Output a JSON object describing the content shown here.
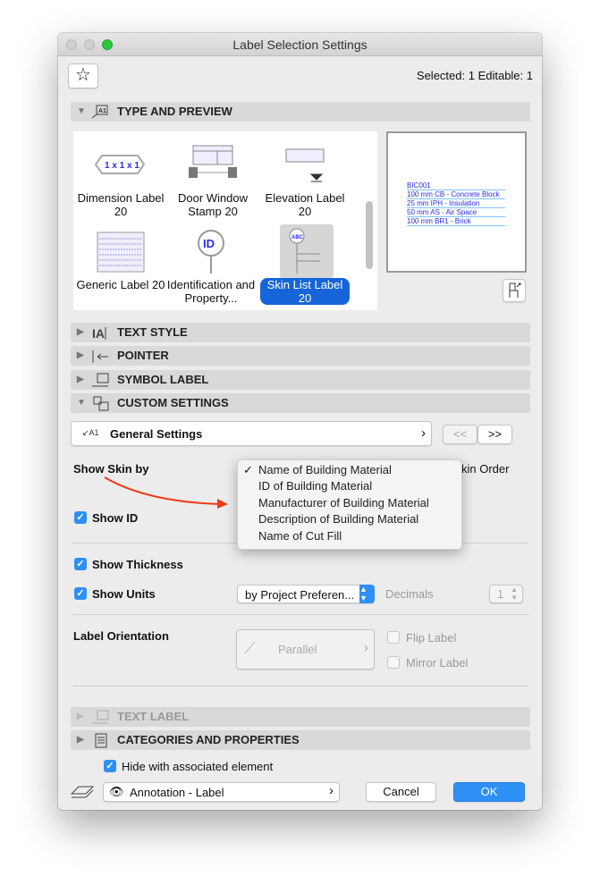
{
  "window": {
    "title": "Label Selection Settings"
  },
  "header": {
    "selected": "Selected: 1 Editable: 1"
  },
  "sections": {
    "type_preview": "TYPE AND PREVIEW",
    "text_style": "TEXT STYLE",
    "pointer": "POINTER",
    "symbol_label": "SYMBOL LABEL",
    "custom_settings": "CUSTOM SETTINGS",
    "text_label": "TEXT LABEL",
    "categories": "CATEGORIES AND PROPERTIES"
  },
  "library": {
    "items": [
      {
        "label": "Dimension Label 20",
        "icon_text": "1 x 1 x 1"
      },
      {
        "label": "Door Window Stamp 20"
      },
      {
        "label": "Elevation Label 20"
      },
      {
        "label": "Generic Label 20"
      },
      {
        "label": "Identification and Property...",
        "icon_text": "ID"
      },
      {
        "label": "Skin List Label 20",
        "selected": true,
        "icon_text": "ABC"
      }
    ]
  },
  "preview": {
    "lines": [
      "BIC001",
      "100 mm  CB - Concrete Block",
      "25 mm  IPH - Insulation",
      "50 mm  AS - Air Space",
      "100 mm  BR1 - Brick"
    ]
  },
  "custom": {
    "page": "General Settings",
    "prev": "<<",
    "next": ">>",
    "show_skin_by": "Show Skin by",
    "skin_order": "kin Order",
    "show_id": "Show ID",
    "show_thickness": "Show Thickness",
    "show_units": "Show Units",
    "units_value": "by Project Preferen...",
    "decimals_label": "Decimals",
    "decimals_value": "1",
    "label_orientation": "Label Orientation",
    "orientation_value": "Parallel",
    "flip_label": "Flip Label",
    "mirror_label": "Mirror Label"
  },
  "dropdown": {
    "options": [
      "Name of Building Material",
      "ID of Building Material",
      "Manufacturer of Building Material",
      "Description of Building Material",
      "Name of Cut Fill"
    ],
    "selected": "Name of Building Material",
    "check": "✓"
  },
  "footer": {
    "hide_with_element": "Hide with associated element",
    "layer": "Annotation - Label",
    "cancel": "Cancel",
    "ok": "OK"
  },
  "colors": {
    "accent": "#2e8ff5",
    "annotation_arrow": "#f03a17"
  }
}
